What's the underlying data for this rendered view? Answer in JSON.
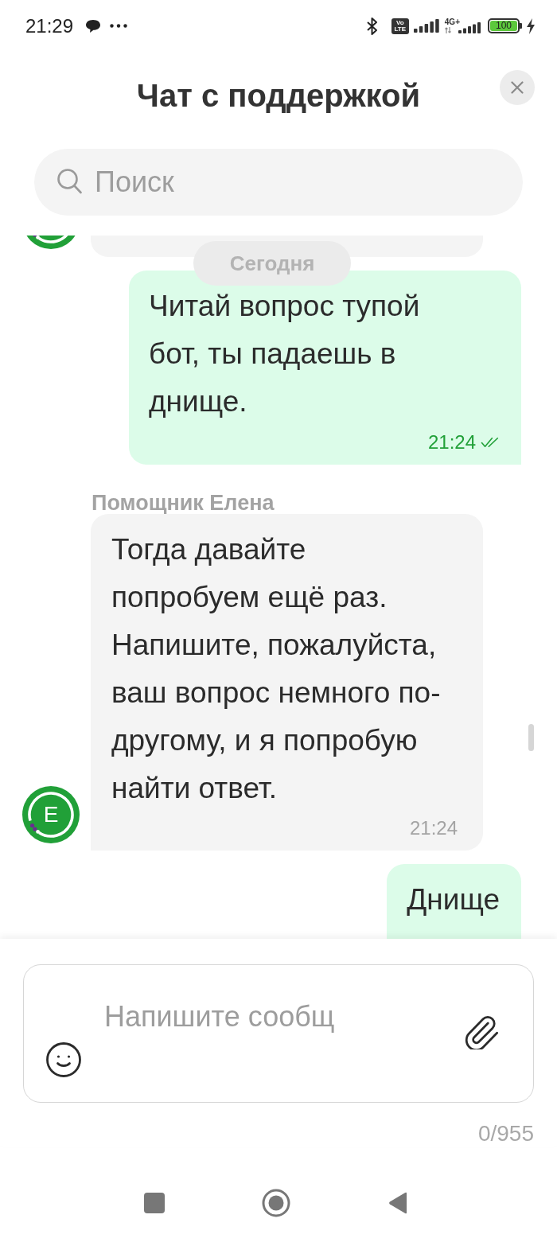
{
  "status_bar": {
    "time": "21:29",
    "volte": [
      "Vo",
      "LTE"
    ],
    "network_type": "4G+",
    "battery": "100",
    "charging": true
  },
  "header": {
    "title": "Чат с поддержкой"
  },
  "search": {
    "placeholder": "Поиск"
  },
  "date_chip": {
    "label": "Сегодня"
  },
  "messages": [
    {
      "kind": "incoming",
      "cropped": true
    },
    {
      "kind": "outgoing",
      "text": "Читай вопрос тупой\nбот, ты падаешь в\nднище.",
      "time": "21:24",
      "read": true
    },
    {
      "kind": "incoming",
      "sender": "Помощник Елена",
      "avatar": "Е",
      "text": "Тогда давайте\nпопробуем ещё раз.\nНапишите, пожалуйста,\nваш вопрос немного по-\nдругому, и я попробую\nнайти ответ.",
      "time": "21:24"
    },
    {
      "kind": "outgoing",
      "text": "Днище",
      "cropped": true
    }
  ],
  "composer": {
    "placeholder": "Напишите сообщ",
    "counter": "0/955"
  }
}
